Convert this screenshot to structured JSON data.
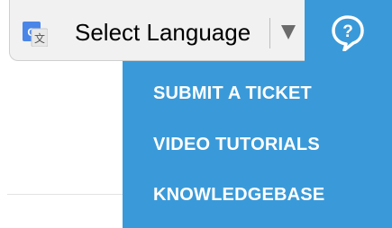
{
  "translate": {
    "label": "Select Language",
    "icon": "google-translate-icon",
    "arrow_icon": "dropdown-arrow-icon"
  },
  "help": {
    "icon": "help-chat-icon",
    "color": "#3a9ad9"
  },
  "menu": {
    "items": [
      {
        "label": "SUBMIT A TICKET"
      },
      {
        "label": "VIDEO TUTORIALS"
      },
      {
        "label": "KNOWLEDGEBASE"
      }
    ],
    "background": "#3a9ad9",
    "text_color": "#ffffff"
  }
}
